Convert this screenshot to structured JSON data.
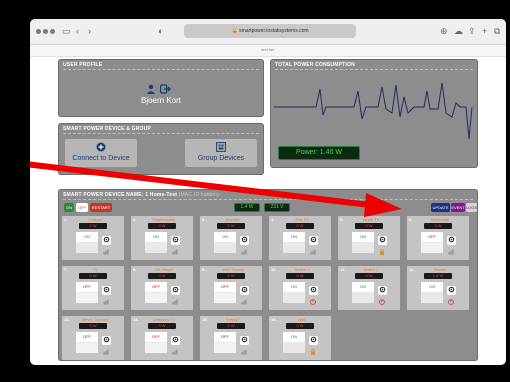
{
  "browser": {
    "url": "smartpower.iostaksystems.com",
    "tab_title": "test tab"
  },
  "user_profile": {
    "title": "USER PROFILE",
    "name": "Bjoern Kort"
  },
  "total_power": {
    "title": "TOTAL POWER CONSUMPTION",
    "readout": "Power: 1.40 W"
  },
  "device_group": {
    "title": "SMART POWER DEVICE & GROUP",
    "connect_label": "Connect to Device",
    "group_label": "Group Devices"
  },
  "device_panel": {
    "title": "SMART POWER DEVICE NAME: 1 Home-Test",
    "subtitle": "(MAC ID hidden)",
    "on_label": "ON",
    "off_label": "OFF",
    "restart_label": "RESTART",
    "total_power": "1.4 W",
    "voltage": "231 V",
    "update_label": "UPDATE",
    "event_label": "EVENT",
    "logs_label": "LOGS"
  },
  "devices": [
    {
      "num": "1.",
      "name": "Charger",
      "power": "0 W",
      "state": "ON",
      "mini_icon": "chart-icon"
    },
    {
      "num": "2.",
      "name": "Powersplitter",
      "power": "0 W",
      "state": "ON",
      "mini_icon": "chart-icon"
    },
    {
      "num": "3.",
      "name": "Amplifier",
      "power": "0 W",
      "state": "ON",
      "mini_icon": "chart-icon"
    },
    {
      "num": "4.",
      "name": "Fire TV",
      "power": "0 W",
      "state": "ON",
      "mini_icon": "chart-icon"
    },
    {
      "num": "5.",
      "name": "Apple TV",
      "power": "0 W",
      "state": "ON",
      "mini_icon": "lock-icon"
    },
    {
      "num": "6.",
      "name": "Subwoofer",
      "power": "0 W",
      "state": "OFF",
      "mini_icon": "chart-icon"
    },
    {
      "num": "7.",
      "name": "TV",
      "power": "0 W",
      "state": "OFF",
      "mini_icon": "chart-icon"
    },
    {
      "num": "8.",
      "name": "CD-Player",
      "power": "0 W",
      "state": "OFF",
      "mini_icon": "chart-icon"
    },
    {
      "num": "9.",
      "name": "WiFi Socket",
      "power": "0 W",
      "state": "OFF",
      "mini_icon": "chart-icon"
    },
    {
      "num": "10.",
      "name": "Switch 1",
      "power": "0 W",
      "state": "ON",
      "mini_icon": "power-icon"
    },
    {
      "num": "11.",
      "name": "Switch 2",
      "power": "0 W",
      "state": "ON",
      "mini_icon": "power-icon"
    },
    {
      "num": "12.",
      "name": "Router",
      "power": "1.4 W",
      "state": "ON",
      "mini_icon": "power-icon"
    },
    {
      "num": "13.",
      "name": "Server Connect",
      "power": "0 W",
      "state": "OFF",
      "mini_icon": "chart-icon"
    },
    {
      "num": "14.",
      "name": "Childrens TV",
      "power": "0 W",
      "state": "OFF",
      "mini_icon": "chart-icon"
    },
    {
      "num": "15.",
      "name": "Empty7",
      "power": "0 W",
      "state": "OFF",
      "mini_icon": "chart-icon"
    },
    {
      "num": "16.",
      "name": "NAS",
      "power": "0 W",
      "state": "ON",
      "mini_icon": "lock-icon"
    }
  ],
  "colors": {
    "panel": "#8d8d8d",
    "accent_green": "#2e8b3a",
    "accent_red": "#c0392b",
    "update_blue": "#1f2f8a",
    "event_purple": "#7d1a8f",
    "arrow_red": "#ee0000"
  }
}
